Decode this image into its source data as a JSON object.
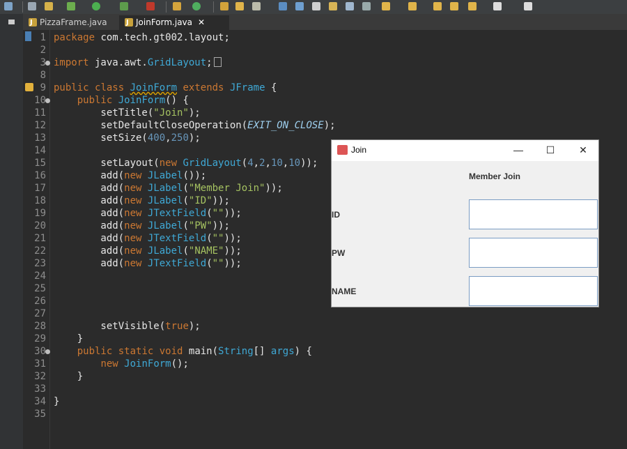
{
  "tabs": [
    {
      "label": "PizzaFrame.java",
      "active": false
    },
    {
      "label": "JoinForm.java",
      "active": true
    }
  ],
  "editor": {
    "lines": [
      {
        "n": "1",
        "code": "package com.tech.gt002.layout;"
      },
      {
        "n": "2",
        "code": ""
      },
      {
        "n": "3",
        "code": "import java.awt.GridLayout;"
      },
      {
        "n": "8",
        "code": ""
      },
      {
        "n": "9",
        "code": "public class JoinForm extends JFrame {"
      },
      {
        "n": "10",
        "code": "    public JoinForm() {"
      },
      {
        "n": "11",
        "code": "        setTitle(\"Join\");"
      },
      {
        "n": "12",
        "code": "        setDefaultCloseOperation(EXIT_ON_CLOSE);"
      },
      {
        "n": "13",
        "code": "        setSize(400,250);"
      },
      {
        "n": "14",
        "code": ""
      },
      {
        "n": "15",
        "code": "        setLayout(new GridLayout(4,2,10,10));"
      },
      {
        "n": "16",
        "code": "        add(new JLabel());"
      },
      {
        "n": "17",
        "code": "        add(new JLabel(\"Member Join\"));"
      },
      {
        "n": "18",
        "code": "        add(new JLabel(\"ID\"));"
      },
      {
        "n": "19",
        "code": "        add(new JTextField(\"\"));"
      },
      {
        "n": "20",
        "code": "        add(new JLabel(\"PW\"));"
      },
      {
        "n": "21",
        "code": "        add(new JTextField(\"\"));"
      },
      {
        "n": "22",
        "code": "        add(new JLabel(\"NAME\"));"
      },
      {
        "n": "23",
        "code": "        add(new JTextField(\"\"));"
      },
      {
        "n": "24",
        "code": ""
      },
      {
        "n": "25",
        "code": ""
      },
      {
        "n": "26",
        "code": ""
      },
      {
        "n": "27",
        "code": ""
      },
      {
        "n": "28",
        "code": "        setVisible(true);"
      },
      {
        "n": "29",
        "code": "    }"
      },
      {
        "n": "30",
        "code": "    public static void main(String[] args) {"
      },
      {
        "n": "31",
        "code": "        new JoinForm();"
      },
      {
        "n": "32",
        "code": "    }"
      },
      {
        "n": "33",
        "code": ""
      },
      {
        "n": "34",
        "code": "}"
      },
      {
        "n": "35",
        "code": ""
      }
    ]
  },
  "window": {
    "title": "Join",
    "minimize": "—",
    "maximize": "☐",
    "close": "✕",
    "header_label": "Member Join",
    "id_label": "ID",
    "id_value": "",
    "pw_label": "PW",
    "pw_value": "",
    "name_label": "NAME",
    "name_value": ""
  },
  "colors": {
    "keyword": "#cc7832",
    "type": "#3fa9d6",
    "string": "#a5c261",
    "number": "#6897bb"
  }
}
